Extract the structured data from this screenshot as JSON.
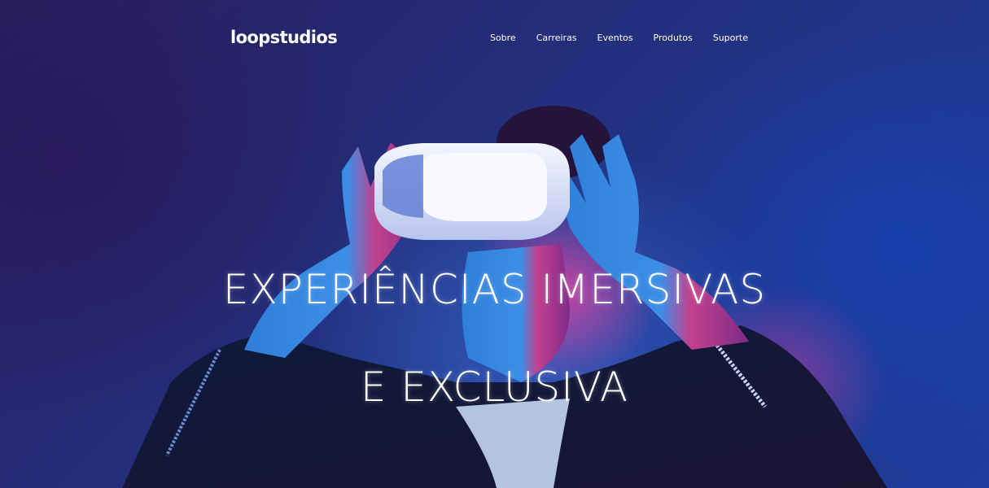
{
  "header": {
    "logo": "loopstudios",
    "nav": [
      {
        "label": "Sobre"
      },
      {
        "label": "Carreiras"
      },
      {
        "label": "Eventos"
      },
      {
        "label": "Produtos"
      },
      {
        "label": "Suporte"
      }
    ]
  },
  "hero": {
    "headline_line1": "EXPERIÊNCIAS IMERSIVAS",
    "headline_line2": "E EXCLUSIVA",
    "image": "person-wearing-vr-headset"
  },
  "colors": {
    "background_dark": "#23307e",
    "background_light": "#1d3e9c",
    "accent_pink": "#d23aa0",
    "text": "#ffffff"
  }
}
